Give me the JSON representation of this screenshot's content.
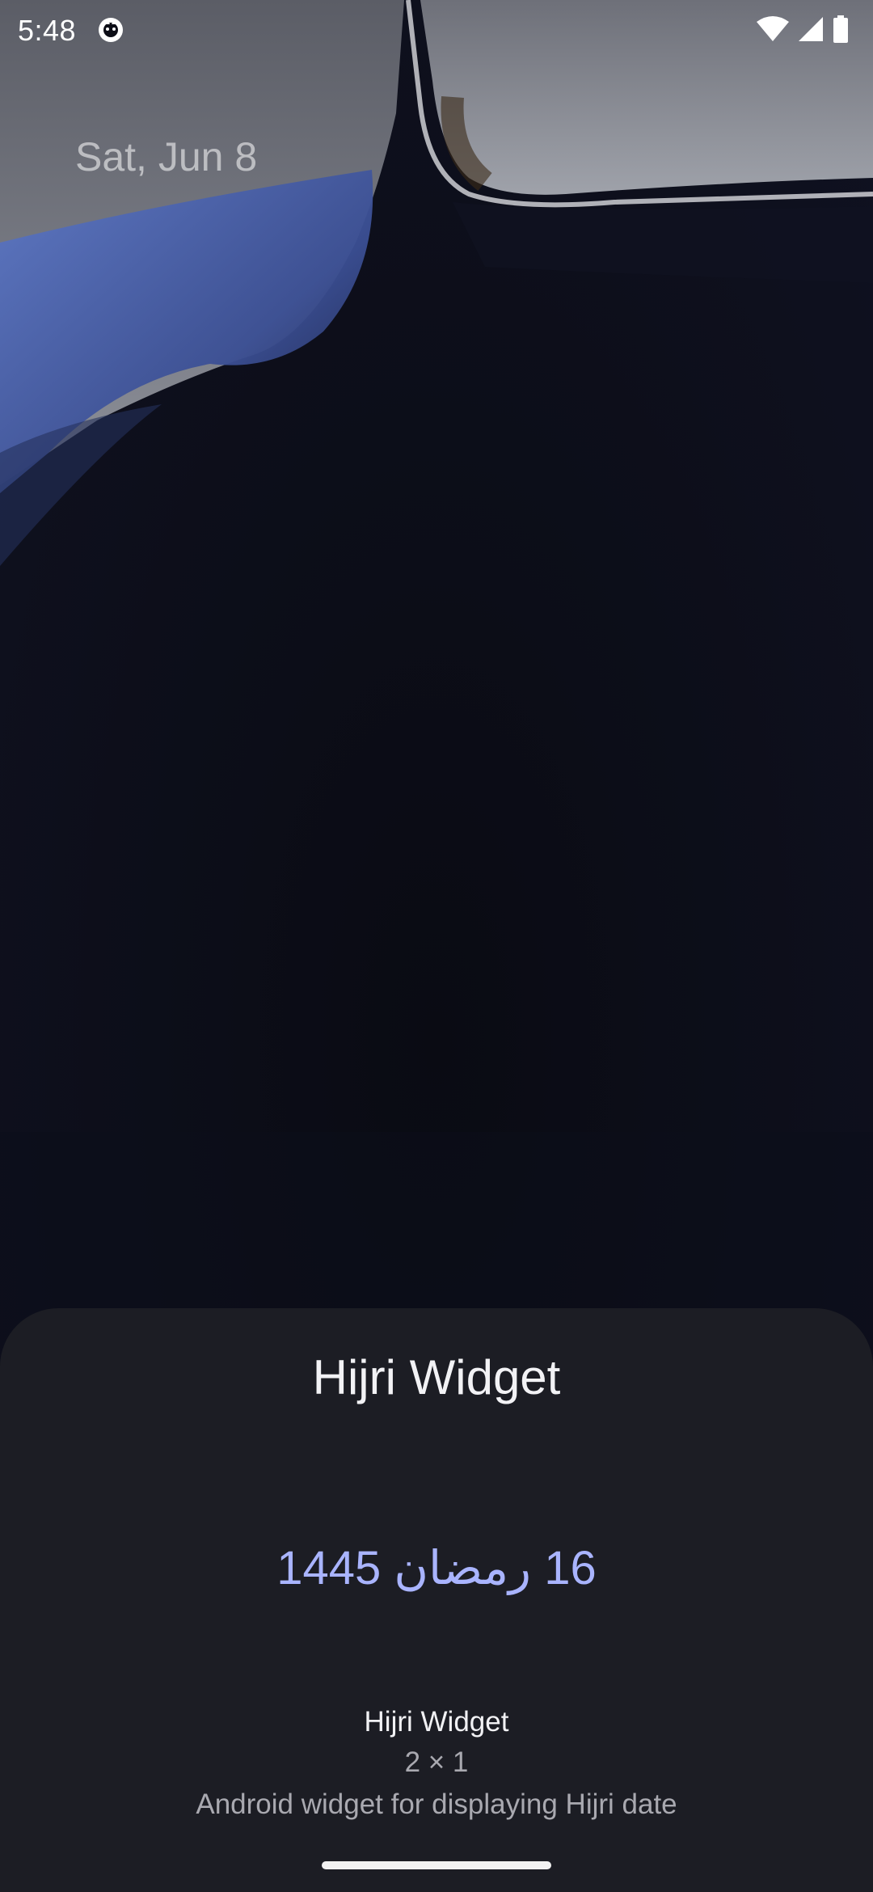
{
  "status_bar": {
    "time": "5:48",
    "icons": [
      "app-notification-icon",
      "wifi-icon",
      "cell-signal-icon",
      "battery-icon"
    ]
  },
  "lock_screen": {
    "date": "Sat, Jun 8"
  },
  "sheet": {
    "title": "Hijri Widget",
    "preview_date": "16 رمضان 1445",
    "widget_name": "Hijri Widget",
    "widget_size": "2 × 1",
    "widget_description": "Android widget for displaying Hijri date"
  },
  "colors": {
    "sheet_background": "#1c1d24",
    "preview_text": "#a9b4ff",
    "title_text": "#f2f2f5",
    "secondary_text": "#a9a9b0"
  }
}
